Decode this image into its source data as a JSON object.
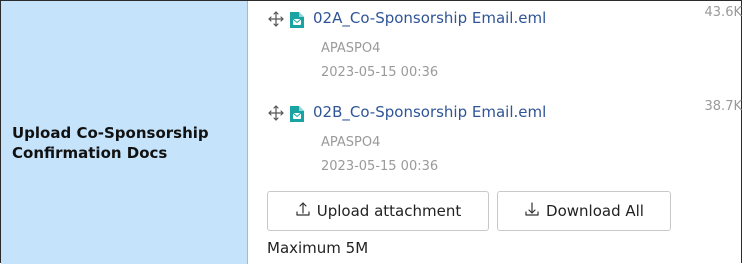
{
  "field": {
    "label_line1": "Upload Co-Sponsorship",
    "label_line2": "Confirmation Docs"
  },
  "attachments": [
    {
      "name": "02A_Co-Sponsorship Email.eml",
      "size": "43.6K",
      "uploader": "APASPO4",
      "timestamp": "2023-05-15 00:36",
      "icon": "move-icon",
      "file_icon": "email-file-icon"
    },
    {
      "name": "02B_Co-Sponsorship Email.eml",
      "size": "38.7K",
      "uploader": "APASPO4",
      "timestamp": "2023-05-15 00:36",
      "icon": "move-icon",
      "file_icon": "email-file-icon"
    }
  ],
  "actions": {
    "upload_label": "Upload attachment",
    "download_label": "Download All"
  },
  "limit_text": "Maximum 5M",
  "colors": {
    "label_bg": "#c5e4fb",
    "link": "#2f5597",
    "muted": "#9a9a9a",
    "file_icon": "#1aa3a3"
  }
}
